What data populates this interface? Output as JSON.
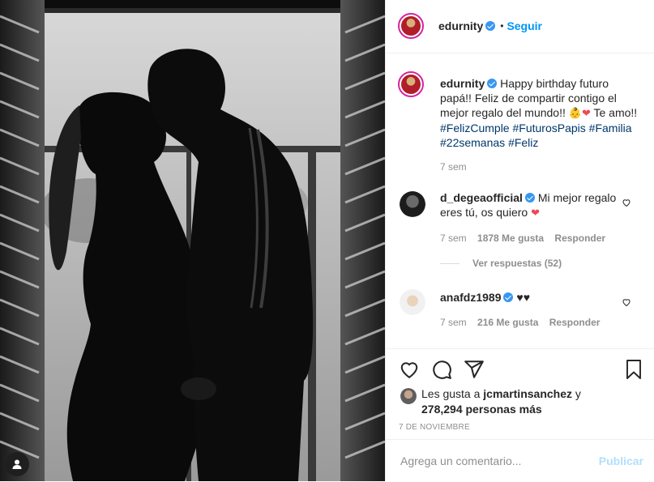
{
  "post": {
    "image_alt": "Black and white photo of a couple kissing in front of a window"
  },
  "header": {
    "username": "edurnity",
    "separator": "•",
    "follow_label": "Seguir"
  },
  "caption": {
    "username": "edurnity",
    "text_1": "Happy birthday futuro papá!! Feliz de compartir contigo el mejor regalo del mundo!!",
    "emoji_baby": "👶",
    "emoji_heart": "❤",
    "text_2": "Te amo!!",
    "hashtags": [
      "#FelizCumple",
      "#FuturosPapis",
      "#Familia",
      "#22semanas",
      "#Feliz"
    ],
    "age": "7 sem"
  },
  "comments": [
    {
      "username": "d_degeaofficial",
      "text": "Mi mejor regalo eres tú, os quiero",
      "emoji": "❤",
      "age": "7 sem",
      "likes": "1878 Me gusta",
      "reply_label": "Responder",
      "view_replies": "Ver respuestas (52)"
    },
    {
      "username": "anafdz1989",
      "text": "♥♥",
      "age": "7 sem",
      "likes": "216 Me gusta",
      "reply_label": "Responder"
    }
  ],
  "likes": {
    "prefix": "Les gusta a",
    "user": "jcmartinsanchez",
    "joiner": "y",
    "count": "278,294 personas más"
  },
  "date": "7 DE NOVIEMBRE",
  "add_comment": {
    "placeholder": "Agrega un comentario...",
    "publish_label": "Publicar"
  },
  "colors": {
    "accent": "#0095f6",
    "heart": "#ed4956",
    "verified": "#3897f0",
    "muted": "#8e8e8e"
  }
}
